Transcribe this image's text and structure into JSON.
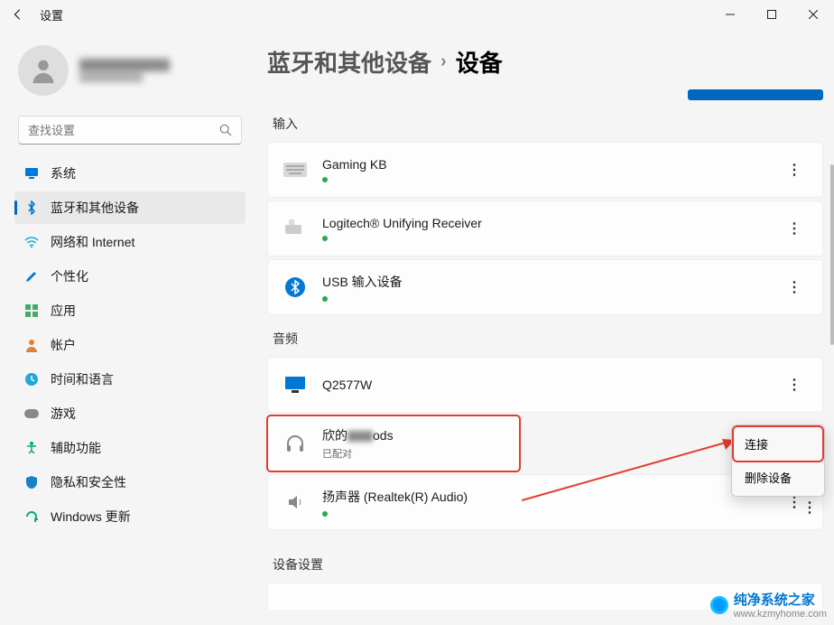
{
  "window": {
    "title": "设置"
  },
  "user": {},
  "search": {
    "placeholder": "查找设置"
  },
  "nav": {
    "items": [
      {
        "label": "系统",
        "icon": "monitor"
      },
      {
        "label": "蓝牙和其他设备",
        "icon": "bluetooth"
      },
      {
        "label": "网络和 Internet",
        "icon": "wifi"
      },
      {
        "label": "个性化",
        "icon": "brush"
      },
      {
        "label": "应用",
        "icon": "apps"
      },
      {
        "label": "帐户",
        "icon": "person"
      },
      {
        "label": "时间和语言",
        "icon": "clock"
      },
      {
        "label": "游戏",
        "icon": "gamepad"
      },
      {
        "label": "辅助功能",
        "icon": "accessibility"
      },
      {
        "label": "隐私和安全性",
        "icon": "shield"
      },
      {
        "label": "Windows 更新",
        "icon": "update"
      }
    ],
    "activeIndex": 1
  },
  "breadcrumb": {
    "parent": "蓝牙和其他设备",
    "current": "设备"
  },
  "sections": {
    "input": {
      "label": "输入",
      "devices": [
        {
          "name": "Gaming KB",
          "icon": "keyboard",
          "hasDot": true
        },
        {
          "name": "Logitech® Unifying Receiver",
          "icon": "receiver",
          "hasDot": true
        },
        {
          "name": "USB 输入设备",
          "icon": "bluetooth-circle",
          "hasDot": true
        }
      ]
    },
    "audio": {
      "label": "音频",
      "devices": [
        {
          "name": "Q2577W",
          "icon": "display",
          "hasDot": false
        },
        {
          "name_prefix": "欣的",
          "name_suffix": "ods",
          "status": "已配对",
          "icon": "headphones",
          "hasDot": false,
          "highlight": true
        },
        {
          "name": "扬声器 (Realtek(R) Audio)",
          "icon": "speaker",
          "hasDot": true
        }
      ]
    },
    "deviceSettings": {
      "label": "设备设置"
    }
  },
  "contextMenu": {
    "connect": "连接",
    "remove": "删除设备"
  },
  "watermark": {
    "brand": "纯净系统之家",
    "url": "www.kzmyhome.com"
  }
}
